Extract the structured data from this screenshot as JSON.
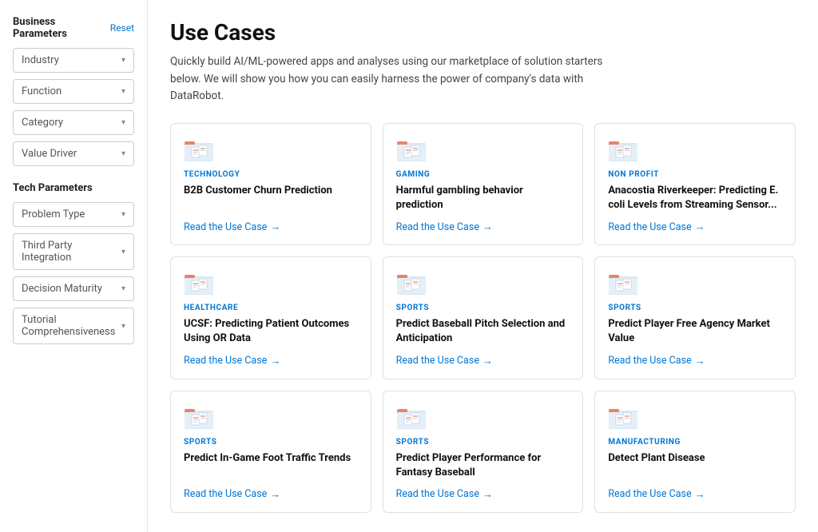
{
  "sidebar": {
    "business_section_title": "Business Parameters",
    "reset_label": "Reset",
    "business_dropdowns": [
      {
        "label": "Industry",
        "id": "industry"
      },
      {
        "label": "Function",
        "id": "function"
      },
      {
        "label": "Category",
        "id": "category"
      },
      {
        "label": "Value Driver",
        "id": "value-driver"
      }
    ],
    "tech_section_title": "Tech Parameters",
    "tech_dropdowns": [
      {
        "label": "Problem Type",
        "id": "problem-type"
      },
      {
        "label": "Third Party Integration",
        "id": "third-party"
      },
      {
        "label": "Decision Maturity",
        "id": "decision-maturity"
      },
      {
        "label": "Tutorial Comprehensiveness",
        "id": "tutorial-comp"
      }
    ]
  },
  "main": {
    "title": "Use Cases",
    "description": "Quickly build AI/ML-powered apps and analyses using our marketplace of solution starters below. We will show you how you can easily harness the power of company's data with DataRobot.",
    "cards": [
      {
        "category": "TECHNOLOGY",
        "title": "B2B Customer Churn Prediction",
        "link": "Read the Use Case"
      },
      {
        "category": "GAMING",
        "title": "Harmful gambling behavior prediction",
        "link": "Read the Use Case"
      },
      {
        "category": "NON PROFIT",
        "title": "Anacostia Riverkeeper: Predicting E. coli Levels from Streaming Sensor...",
        "link": "Read the Use Case"
      },
      {
        "category": "HEALTHCARE",
        "title": "UCSF: Predicting Patient Outcomes Using OR Data",
        "link": "Read the Use Case"
      },
      {
        "category": "SPORTS",
        "title": "Predict Baseball Pitch Selection and Anticipation",
        "link": "Read the Use Case"
      },
      {
        "category": "SPORTS",
        "title": "Predict Player Free Agency Market Value",
        "link": "Read the Use Case"
      },
      {
        "category": "SPORTS",
        "title": "Predict In-Game Foot Traffic Trends",
        "link": "Read the Use Case"
      },
      {
        "category": "SPORTS",
        "title": "Predict Player Performance for Fantasy Baseball",
        "link": "Read the Use Case"
      },
      {
        "category": "MANUFACTURING",
        "title": "Detect Plant Disease",
        "link": "Read the Use Case"
      }
    ]
  }
}
